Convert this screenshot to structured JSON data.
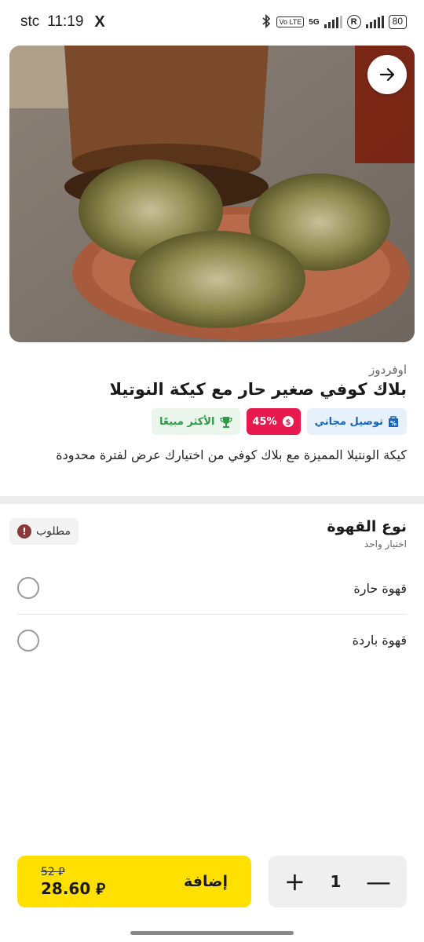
{
  "status_bar": {
    "carrier": "stc",
    "time": "11:19",
    "x_icon": "X",
    "volte": "Vo LTE",
    "net": "5G",
    "battery": "80"
  },
  "hero": {
    "back_icon": "arrow-right-icon"
  },
  "product": {
    "brand": "اوفردوز",
    "title": "بلاك كوفي صغير حار مع كيكة النوتيلا",
    "badges": {
      "delivery": "توصيل مجاني",
      "discount": "45%",
      "best_seller": "الأكثر مبيعًا"
    },
    "description": "كيكة الونتيلا المميزة مع بلاك كوفي من اختيارك عرض لفترة محدودة"
  },
  "options": {
    "title": "نوع القهوة",
    "subtitle": "اختيار واحد",
    "required": "مطلوب",
    "items": [
      {
        "label": "قهوة حارة"
      },
      {
        "label": "قهوة باردة"
      }
    ]
  },
  "cart": {
    "quantity": "1",
    "plus": "+",
    "minus": "—",
    "add_label": "إضافة",
    "old_price": "52 ⃁",
    "new_price": "28.60 ⃁"
  },
  "colors": {
    "accent": "#ffe000",
    "discount": "#e8194f",
    "delivery": "#1565c0",
    "best_seller": "#2e9a47"
  }
}
